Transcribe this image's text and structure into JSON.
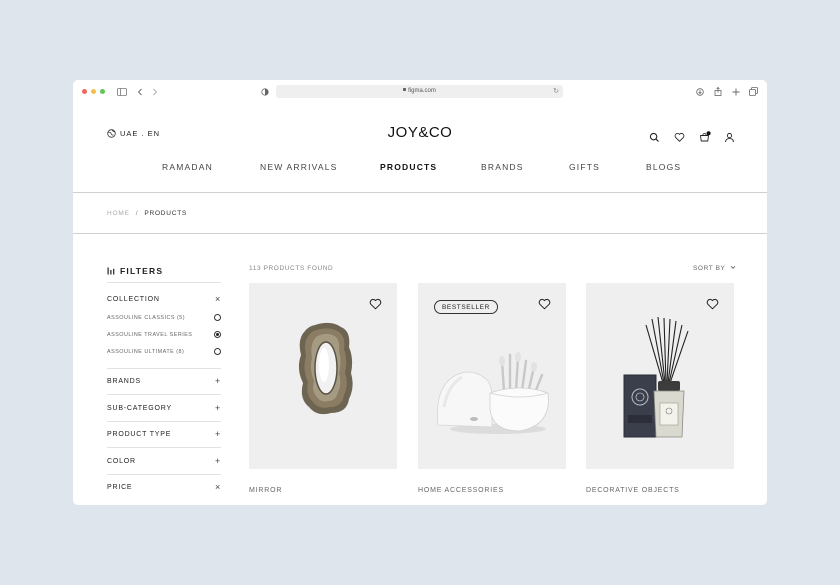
{
  "browser": {
    "url": "figma.com"
  },
  "header": {
    "locale": "UAE . EN",
    "logo": "JOY&CO",
    "icons": [
      "search-icon",
      "heart-icon",
      "cart-icon",
      "user-icon"
    ]
  },
  "nav": {
    "items": [
      {
        "label": "RAMADAN"
      },
      {
        "label": "NEW ARRIVALS"
      },
      {
        "label": "PRODUCTS"
      },
      {
        "label": "BRANDS"
      },
      {
        "label": "GIFTS"
      },
      {
        "label": "BLOGS"
      }
    ],
    "active": "PRODUCTS"
  },
  "breadcrumb": {
    "home": "HOME",
    "separator": "/",
    "current": "PRODUCTS"
  },
  "filters": {
    "title": "FILTERS",
    "collection": {
      "label": "COLLECTION",
      "options": [
        {
          "label": "ASSOULINE CLASSICS (5)",
          "selected": false
        },
        {
          "label": "ASSOULINE TRAVEL SERIES",
          "selected": true
        },
        {
          "label": "ASSOULINE ULTIMATE (8)",
          "selected": false
        }
      ]
    },
    "sections": [
      {
        "label": "BRANDS",
        "expanded": false
      },
      {
        "label": "SUB-CATEGORY",
        "expanded": false
      },
      {
        "label": "PRODUCT TYPE",
        "expanded": false
      },
      {
        "label": "COLOR",
        "expanded": false
      },
      {
        "label": "PRICE",
        "expanded": true
      }
    ]
  },
  "results": {
    "count_text": "113 PRODUCTS FOUND",
    "sort_label": "SORT BY"
  },
  "products": [
    {
      "category": "MIRROR",
      "badge": ""
    },
    {
      "category": "HOME ACCESSORIES",
      "badge": "BESTSELLER"
    },
    {
      "category": "DECORATIVE OBJECTS",
      "badge": ""
    }
  ],
  "colors": {
    "background": "#dfe5ec",
    "card": "#efeff0",
    "text": "#222222"
  }
}
